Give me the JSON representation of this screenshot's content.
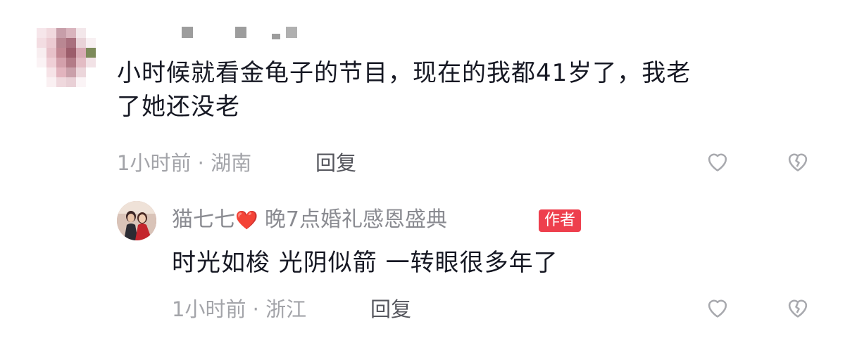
{
  "comment": {
    "text": "小时候就看金龟子的节目，现在的我都41岁了，我老了她还没老",
    "line1": "小时候就看金龟子的节目，现在的我都41岁了，我老",
    "line2": "了她还没老",
    "meta": "1小时前 · 湖南",
    "reply_label": "回复"
  },
  "reply": {
    "username": "猫七七",
    "emoji": "❤️",
    "tagline": "晚7点婚礼感恩盛典",
    "badge": "作者",
    "text": "时光如梭 光阴似箭 一转眼很多年了",
    "meta": "1小时前 · 浙江",
    "reply_label": "回复"
  },
  "colors": {
    "accent_badge": "#ee3f4d",
    "text_primary": "#161823",
    "text_secondary": "#a3a4a9"
  },
  "icons": [
    "like-heart-icon",
    "dislike-broken-heart-icon"
  ]
}
